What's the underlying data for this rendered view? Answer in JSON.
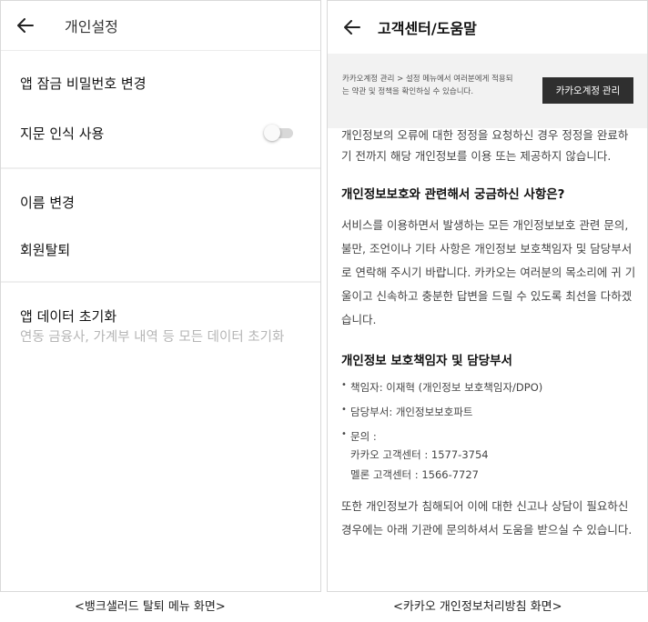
{
  "left": {
    "header_title": "개인설정",
    "items": {
      "app_lock": "앱 잠금 비밀번호 변경",
      "fingerprint": "지문 인식 사용",
      "change_name": "이름 변경",
      "withdraw": "회원탈퇴",
      "data_reset": "앱 데이터 초기화",
      "data_reset_sub": "연동 금융사, 가계부 내역 등 모든 데이터 초기화"
    },
    "fingerprint_toggle": "off"
  },
  "right": {
    "header_title": "고객센터/도움말",
    "notice_text": "카카오계정 관리 > 설정 메뉴에서 여러분에게 적용되는 약관 및 정책을 확인하실 수 있습니다.",
    "notice_button": "카카오계정 관리",
    "para1": "개인정보의 오류에 대한 정정을 요청하신 경우 정정을 완료하기 전까지 해당 개인정보를 이용 또는 제공하지 않습니다.",
    "heading1": "개인정보보호와 관련해서 궁금하신 사항은?",
    "para2": "서비스를 이용하면서 발생하는 모든 개인정보보호 관련 문의, 불만, 조언이나 기타 사항은 개인정보 보호책임자 및 담당부서로 연락해 주시기 바랍니다. 카카오는 여러분의 목소리에 귀 기울이고 신속하고 충분한 답변을 드릴 수 있도록 최선을 다하겠습니다.",
    "heading2": "개인정보 보호책임자 및 담당부서",
    "officer": "책임자: 이재혁 (개인정보 보호책임자/DPO)",
    "department": "담당부서: 개인정보보호파트",
    "inquiry_label": "문의 :",
    "kakao_center": "카카오 고객센터 : 1577-3754",
    "melon_center": "멜론 고객센터 : 1566-7727",
    "para3": "또한 개인정보가 침해되어 이에 대한 신고나 상담이 필요하신 경우에는 아래 기관에 문의하셔서 도움을 받으실 수 있습니다."
  },
  "captions": {
    "left": "<뱅크샐러드 탈퇴 메뉴 화면>",
    "right": "<카카오 개인정보처리방침 화면>"
  }
}
